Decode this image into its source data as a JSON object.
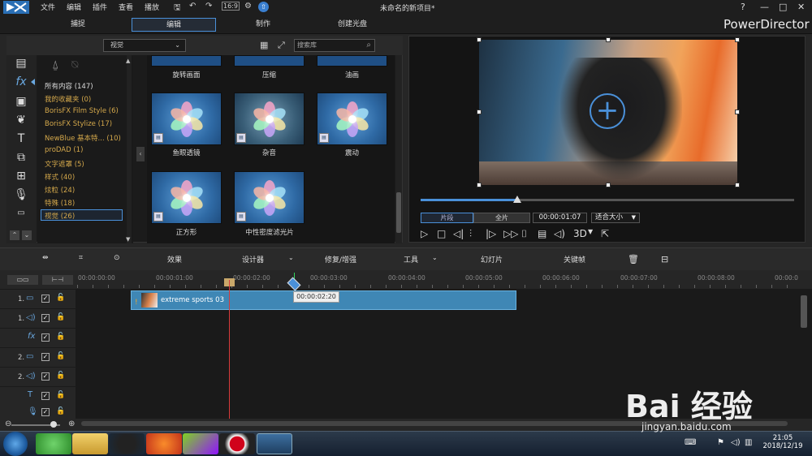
{
  "menu": [
    "文件",
    "编辑",
    "插件",
    "查看",
    "播放"
  ],
  "document_title": "未命名的新项目*",
  "window_controls": [
    "?",
    "—",
    "□",
    "✕"
  ],
  "mode_tabs": [
    "捕捉",
    "编辑",
    "制作",
    "创建光盘"
  ],
  "brand": "PowerDirector",
  "library": {
    "view_select": "视觉",
    "search_placeholder": "搜索库",
    "categories": [
      "所有内容 (147)",
      "我的收藏夹 (0)",
      "BorisFX Film Style (6)",
      "BorisFX Stylize (17)",
      "NewBlue 基本特... (10)",
      "proDAD (1)",
      "文字遮罩 (5)",
      "样式 (40)",
      "炫粒 (24)",
      "特殊 (18)",
      "视觉 (26)"
    ],
    "selected_category": "视觉 (26)",
    "effects_top_row": [
      "旋转画面",
      "压缩",
      "油画"
    ],
    "effects": [
      "鱼眼透镜",
      "杂音",
      "震动",
      "正方形",
      "中性密度滤光片"
    ]
  },
  "preview": {
    "segment_clip": "片段",
    "segment_full": "全片",
    "timecode": "00:00:01:07",
    "fit": "适合大小",
    "three_d": "3D"
  },
  "timeline_toolbar": {
    "effects": "效果",
    "designer": "设计器",
    "fix_enhance": "修复/增强",
    "tools": "工具",
    "slideshow": "幻灯片",
    "keyframe": "关键帧"
  },
  "ruler": [
    "00:00:00:00",
    "00:00:01:00",
    "00:00:02:00",
    "00:00:03:00",
    "00:00:04:00",
    "00:00:05:00",
    "00:00:06:00",
    "00:00:07:00",
    "00:00:08:00",
    "00:00:0"
  ],
  "tracks": [
    {
      "num": "1.",
      "icon": "video-track-icon"
    },
    {
      "num": "1.",
      "icon": "audio-track-icon"
    },
    {
      "num": "",
      "icon": "fx-track-icon"
    },
    {
      "num": "2.",
      "icon": "video-track-icon"
    },
    {
      "num": "2.",
      "icon": "audio-track-icon"
    },
    {
      "num": "",
      "icon": "title-track-icon"
    },
    {
      "num": "",
      "icon": "voice-track-icon"
    }
  ],
  "clip_name": "extreme sports 03",
  "drag_tooltip": "00:00:02:20",
  "taskbar": {
    "time": "21:05",
    "date": "2018/12/19"
  },
  "watermark": {
    "logo": "Bai 经验",
    "url": "jingyan.baidu.com"
  },
  "colors": {
    "accent": "#4a90d9",
    "category_text": "#d4a84b",
    "clip": "#3f87b5",
    "playhead": "#d83b3b"
  }
}
